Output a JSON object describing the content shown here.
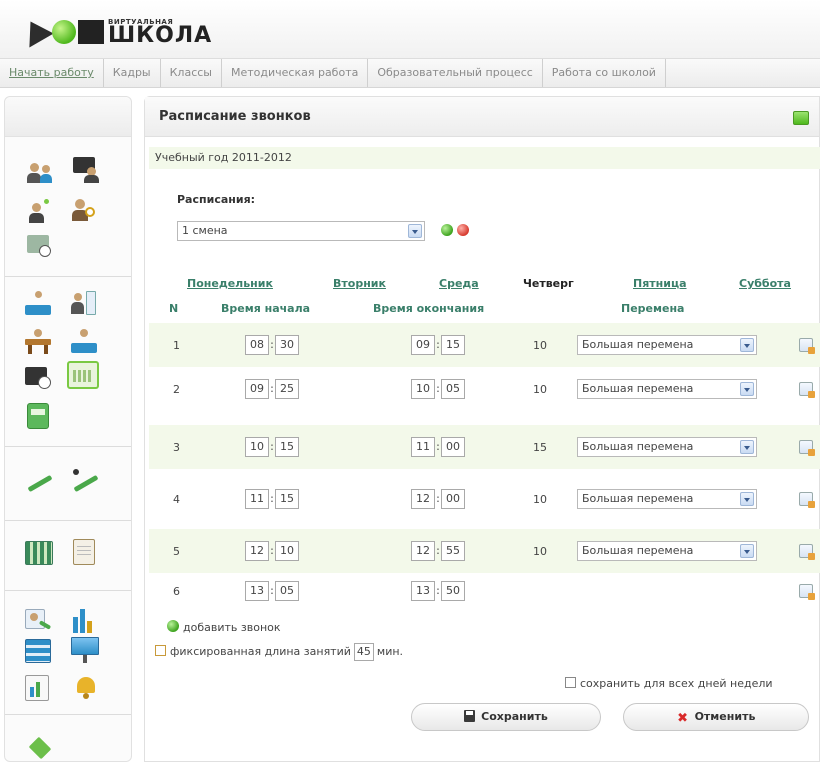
{
  "logo": {
    "top": "ВИРТУАЛЬНАЯ",
    "main": "ШКОЛА"
  },
  "topnav": [
    {
      "label": "Начать работу",
      "active": true
    },
    {
      "label": "Кадры"
    },
    {
      "label": "Классы"
    },
    {
      "label": "Методическая работа"
    },
    {
      "label": "Образовательный процесс"
    },
    {
      "label": "Работа со школой"
    }
  ],
  "panel": {
    "title": "Расписание звонков",
    "year": "Учебный год 2011-2012"
  },
  "schedule": {
    "label": "Расписания:",
    "selected": "1 смена"
  },
  "days": [
    "Понедельник",
    "Вторник",
    "Среда",
    "Четверг",
    "Пятница",
    "Суббота"
  ],
  "columns": {
    "num": "N",
    "start": "Время начала",
    "end": "Время окончания",
    "break": "Перемена"
  },
  "rows": [
    {
      "n": "1",
      "sh": "08",
      "sm": "30",
      "eh": "09",
      "em": "15",
      "len": "10",
      "brk": "Большая перемена"
    },
    {
      "n": "2",
      "sh": "09",
      "sm": "25",
      "eh": "10",
      "em": "05",
      "len": "10",
      "brk": "Большая перемена"
    },
    {
      "n": "3",
      "sh": "10",
      "sm": "15",
      "eh": "11",
      "em": "00",
      "len": "15",
      "brk": "Большая перемена"
    },
    {
      "n": "4",
      "sh": "11",
      "sm": "15",
      "eh": "12",
      "em": "00",
      "len": "10",
      "brk": "Большая перемена"
    },
    {
      "n": "5",
      "sh": "12",
      "sm": "10",
      "eh": "12",
      "em": "55",
      "len": "10",
      "brk": "Большая перемена"
    },
    {
      "n": "6",
      "sh": "13",
      "sm": "05",
      "eh": "13",
      "em": "50",
      "len": "",
      "brk": ""
    }
  ],
  "add_bell": "добавить звонок",
  "fixed": {
    "label": "фиксированная длина занятий",
    "value": "45",
    "unit": "мин."
  },
  "save_all": "сохранить для всех дней недели",
  "buttons": {
    "save": "Сохранить",
    "cancel": "Отменить"
  },
  "colors": {
    "accent_green": "#4fb81d",
    "row_alt": "#f3f9ea",
    "link": "#3a7f6a"
  }
}
